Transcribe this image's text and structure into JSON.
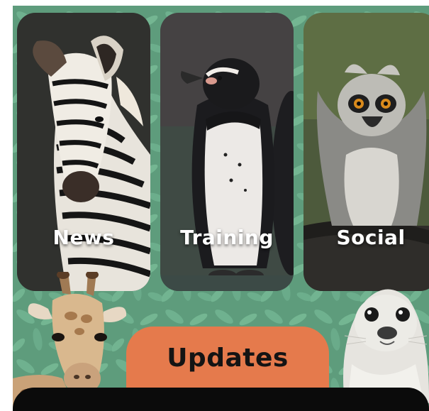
{
  "cards": [
    {
      "label": "News",
      "icon": "zebra-image"
    },
    {
      "label": "Training",
      "icon": "penguin-image"
    },
    {
      "label": "Social",
      "icon": "lemur-image"
    }
  ],
  "updates": {
    "label": "Updates"
  },
  "colors": {
    "background_green": "#5e9c7c",
    "leaf_green": "#6fb18f",
    "updates_orange": "#e57a4c",
    "bottom_bar": "#0b0b0b"
  }
}
